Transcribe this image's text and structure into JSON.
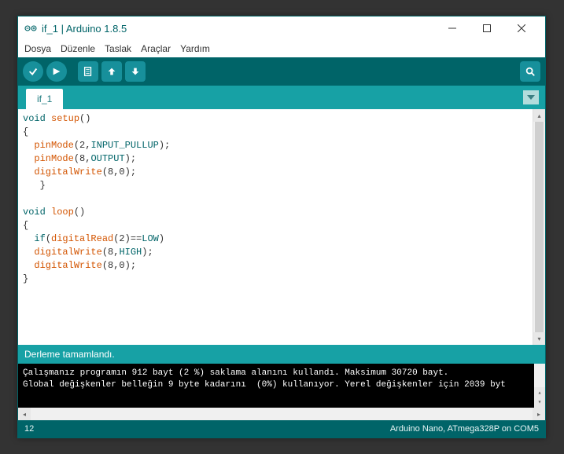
{
  "title": "if_1 | Arduino 1.8.5",
  "menu": [
    "Dosya",
    "Düzenle",
    "Taslak",
    "Araçlar",
    "Yardım"
  ],
  "tab": "if_1",
  "code": {
    "l1_kw": "void ",
    "l1_fn": "setup",
    "l1_rest": "()",
    "l2": "{",
    "l3_indent": "  ",
    "l3_fn": "pinMode",
    "l3_open": "(2,",
    "l3_const": "INPUT_PULLUP",
    "l3_close": ");",
    "l4_indent": "  ",
    "l4_fn": "pinMode",
    "l4_open": "(8,",
    "l4_const": "OUTPUT",
    "l4_close": ");",
    "l5_indent": "  ",
    "l5_fn": "digitalWrite",
    "l5_rest": "(8,0);",
    "l6": "   }",
    "l7": "",
    "l8_kw": "void ",
    "l8_fn": "loop",
    "l8_rest": "()",
    "l9": "{",
    "l10_indent": "  ",
    "l10_if": "if",
    "l10_open": "(",
    "l10_fn": "digitalRead",
    "l10_mid": "(2)==",
    "l10_const": "LOW",
    "l10_close": ")",
    "l11_indent": "  ",
    "l11_fn": "digitalWrite",
    "l11_open": "(8,",
    "l11_const": "HIGH",
    "l11_close": ");",
    "l12_indent": "  ",
    "l12_fn": "digitalWrite",
    "l12_rest": "(8,0);",
    "l13": "}"
  },
  "status": "Derleme tamamlandı.",
  "console": {
    "line1": "Çalışmanız programın 912 bayt (2 %) saklama alanını kullandı. Maksimum 30720 bayt.",
    "line2": "Global değişkenler belleğin 9 byte kadarını  (0%) kullanıyor. Yerel değişkenler için 2039 byt"
  },
  "footer": {
    "line": "12",
    "board": "Arduino Nano, ATmega328P on COM5"
  },
  "colors": {
    "teal_dark": "#006468",
    "teal": "#17a1a5"
  }
}
